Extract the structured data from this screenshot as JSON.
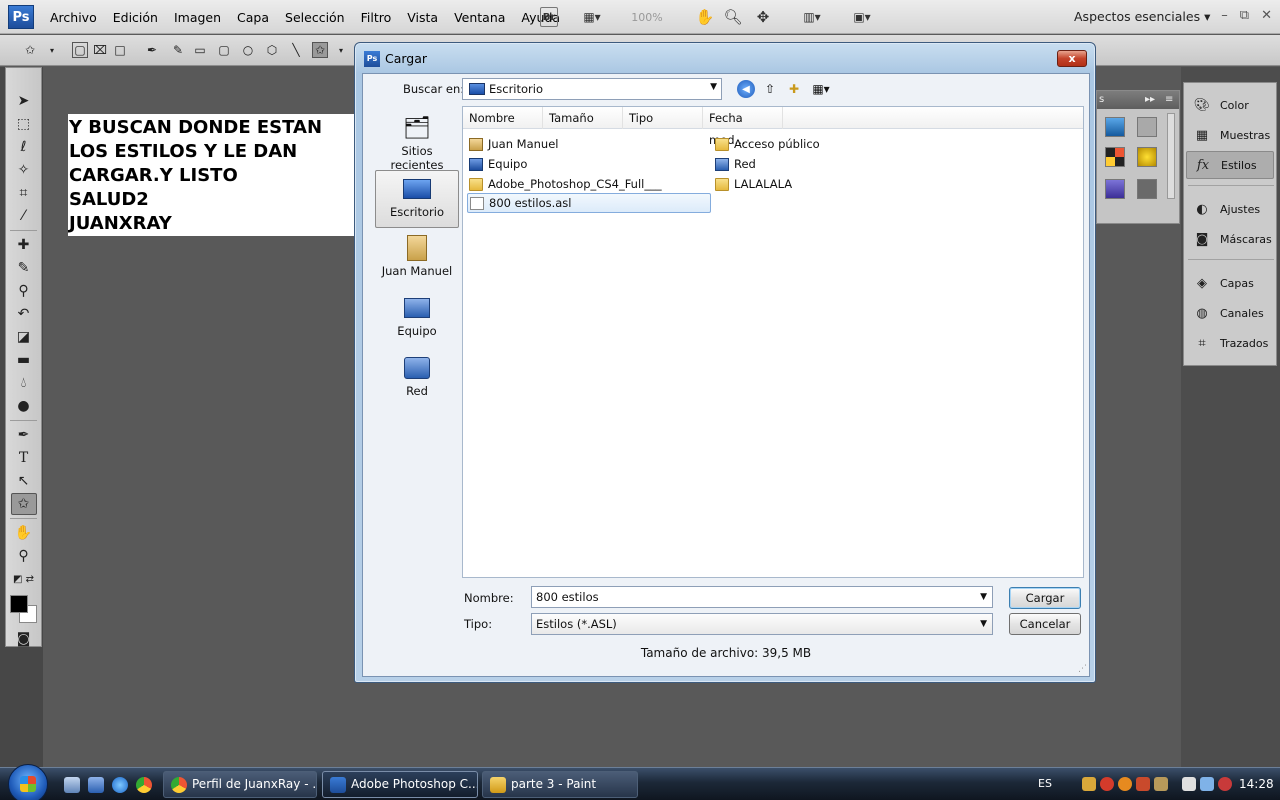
{
  "menubar": {
    "logo": "Ps",
    "menus": [
      "Archivo",
      "Edición",
      "Imagen",
      "Capa",
      "Selección",
      "Filtro",
      "Vista",
      "Ventana",
      "Ayuda"
    ],
    "bridge": "Br",
    "zoom": "100%",
    "workspace": "Aspectos esenciales"
  },
  "document": {
    "lines": [
      "Y BUSCAN DONDE ESTAN",
      "LOS ESTILOS Y LE DAN",
      "CARGAR.Y LISTO",
      "SALUD2",
      "JUANXRAY"
    ]
  },
  "right_panel": {
    "items": [
      "Color",
      "Muestras",
      "Estilos",
      "Ajustes",
      "Máscaras",
      "Capas",
      "Canales",
      "Trazados"
    ],
    "selected": "Estilos"
  },
  "styles_panel": {
    "tab_fragment": "s"
  },
  "dialog": {
    "title": "Cargar",
    "close": "x",
    "look_in_label": "Buscar en:",
    "look_in_value": "Escritorio",
    "places": [
      "Sitios recientes",
      "Escritorio",
      "Juan Manuel",
      "Equipo",
      "Red"
    ],
    "selected_place": "Escritorio",
    "columns": [
      "Nombre",
      "Tamaño",
      "Tipo",
      "Fecha mod..."
    ],
    "files_left": [
      {
        "name": "Juan Manuel",
        "icon": "user-folder-icon"
      },
      {
        "name": "Equipo",
        "icon": "computer-icon"
      },
      {
        "name": "Adobe_Photoshop_CS4_Full___",
        "icon": "folder-icon"
      },
      {
        "name": "800 estilos.asl",
        "icon": "document-icon"
      }
    ],
    "files_right": [
      {
        "name": "Acceso público",
        "icon": "folder-icon"
      },
      {
        "name": "Red",
        "icon": "network-icon"
      },
      {
        "name": "LALALALA",
        "icon": "folder-icon"
      }
    ],
    "selected_file": "800 estilos.asl",
    "name_label": "Nombre:",
    "name_value": "800 estilos",
    "type_label": "Tipo:",
    "type_value": "Estilos (*.ASL)",
    "load_button": "Cargar",
    "cancel_button": "Cancelar",
    "file_size": "Tamaño de archivo: 39,5 MB"
  },
  "taskbar": {
    "tasks": [
      "Perfil de JuanxRay - ...",
      "Adobe Photoshop C...",
      "parte 3 - Paint"
    ],
    "active_task": "Adobe Photoshop C...",
    "language": "ES",
    "clock": "14:28"
  },
  "colors": {
    "ps_blue": "#1d4d9a",
    "dialog_frame": "#aac7e3",
    "selection": "#dcebfa"
  }
}
